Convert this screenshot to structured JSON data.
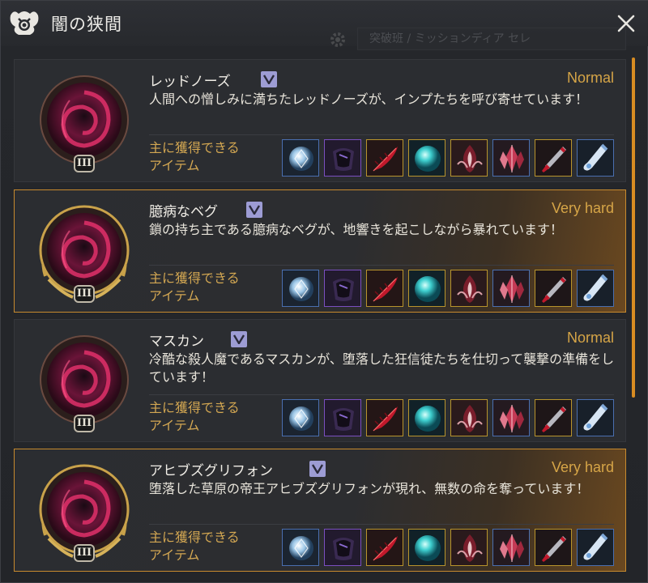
{
  "window": {
    "title": "闇の狭間",
    "ghost_search": "突破班 / ミッションディア セレ"
  },
  "items_label": "主に獲得できる\nアイテム",
  "bosses": [
    {
      "name": "レッドノーズ",
      "difficulty": "Normal",
      "description": "人間への憎しみに満ちたレッドノーズが、インプたちを呼び寄せています！",
      "tier": "III"
    },
    {
      "name": "臆病なベグ",
      "difficulty": "Very hard",
      "description": "鎖の持ち主である臆病なベグが、地響きを起こしながら暴れています！",
      "tier": "III"
    },
    {
      "name": "マスカン",
      "difficulty": "Normal",
      "description": "冷酷な殺人魔であるマスカンが、堕落した狂信徒たちを仕切って襲撃の準備をしています！",
      "tier": "III"
    },
    {
      "name": "アヒブズグリフォン",
      "difficulty": "Very hard",
      "description": "堕落した草原の帝王アヒブズグリフォンが現れ、無数の命を奪っています！",
      "tier": "III"
    }
  ],
  "item_icons": [
    {
      "name": "crystal-orb-icon",
      "border": "#4a6fb0"
    },
    {
      "name": "dark-armor-icon",
      "border": "#7a4fc0"
    },
    {
      "name": "red-feather-icon",
      "border": "#b8942c"
    },
    {
      "name": "teal-orb-icon",
      "border": "#b8942c"
    },
    {
      "name": "red-flame-icon",
      "border": "#b8942c"
    },
    {
      "name": "red-crystal-icon",
      "border": "#4a6fb0"
    },
    {
      "name": "red-dagger-icon",
      "border": "#b8942c"
    },
    {
      "name": "potion-vial-icon",
      "border": "#4a6fb0"
    }
  ],
  "colors": {
    "difficulty": "#d6a547",
    "items_label": "#d3a752",
    "hard_border": "#c78a2e",
    "scrollbar": "#d88c22"
  }
}
